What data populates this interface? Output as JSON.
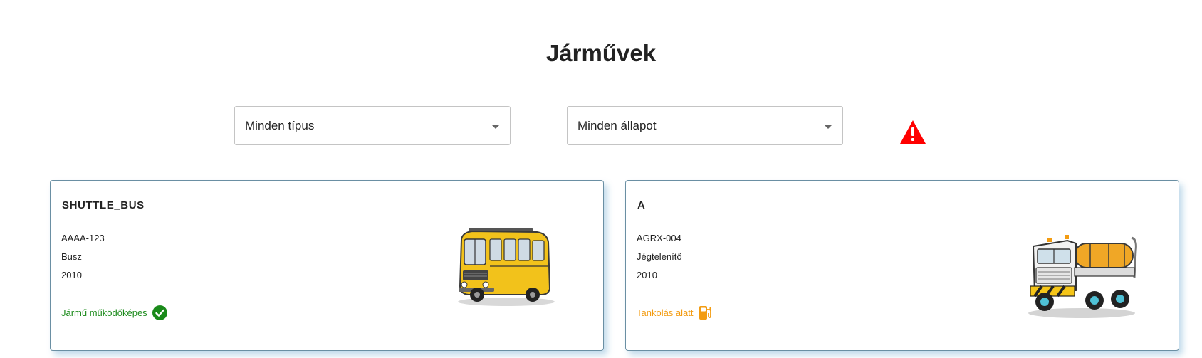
{
  "page": {
    "title": "Járművek"
  },
  "filters": {
    "type_select": {
      "value": "Minden típus"
    },
    "status_select": {
      "value": "Minden állapot"
    }
  },
  "alert": {
    "icon": "warning-triangle-icon",
    "color": "#ff0000"
  },
  "vehicles": [
    {
      "name": "SHUTTLE_BUS",
      "plate": "AAAA-123",
      "type": "Busz",
      "year": "2010",
      "status": "Jármű működőképes",
      "status_icon": "check-circle-icon",
      "status_color": "#1a8a1a",
      "image": "yellow-bus-illustration"
    },
    {
      "name": "A",
      "plate": "AGRX-004",
      "type": "Jégtelenítő",
      "year": "2010",
      "status": "Tankolás alatt",
      "status_icon": "fuel-pump-icon",
      "status_color": "#f39c12",
      "image": "deicing-truck-illustration"
    }
  ]
}
